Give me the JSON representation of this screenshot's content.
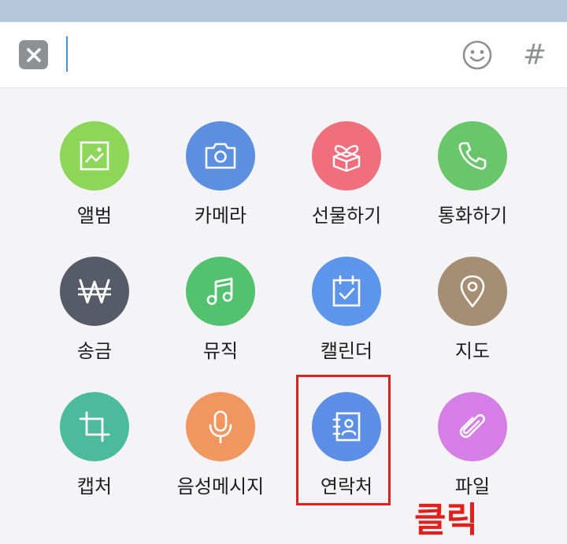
{
  "input_bar": {
    "close_icon": "close-icon",
    "emoji_icon": "smiley-icon",
    "hash_label": "#"
  },
  "colors": {
    "top_bar": "#b4c7dd",
    "album": "#8ed65a",
    "camera": "#5d8fe0",
    "gift": "#ef6f7c",
    "call": "#69c66b",
    "money": "#565c67",
    "music": "#52c26e",
    "calendar": "#5d95ea",
    "map": "#a68e75",
    "capture": "#4bbb9b",
    "voice": "#f0965f",
    "contact": "#5d8ee6",
    "file": "#d47ee6",
    "highlight": "#e0201c"
  },
  "menu": {
    "items": [
      {
        "label": "앨범",
        "icon": "picture-icon"
      },
      {
        "label": "카메라",
        "icon": "camera-icon"
      },
      {
        "label": "선물하기",
        "icon": "gift-icon"
      },
      {
        "label": "통화하기",
        "icon": "phone-icon"
      },
      {
        "label": "송금",
        "icon": "won-icon"
      },
      {
        "label": "뮤직",
        "icon": "music-note-icon"
      },
      {
        "label": "캘린더",
        "icon": "calendar-icon"
      },
      {
        "label": "지도",
        "icon": "location-pin-icon"
      },
      {
        "label": "캡처",
        "icon": "crop-icon"
      },
      {
        "label": "음성메시지",
        "icon": "microphone-icon"
      },
      {
        "label": "연락처",
        "icon": "contact-book-icon"
      },
      {
        "label": "파일",
        "icon": "paperclip-icon"
      }
    ]
  },
  "annotation": {
    "text": "클릭"
  }
}
